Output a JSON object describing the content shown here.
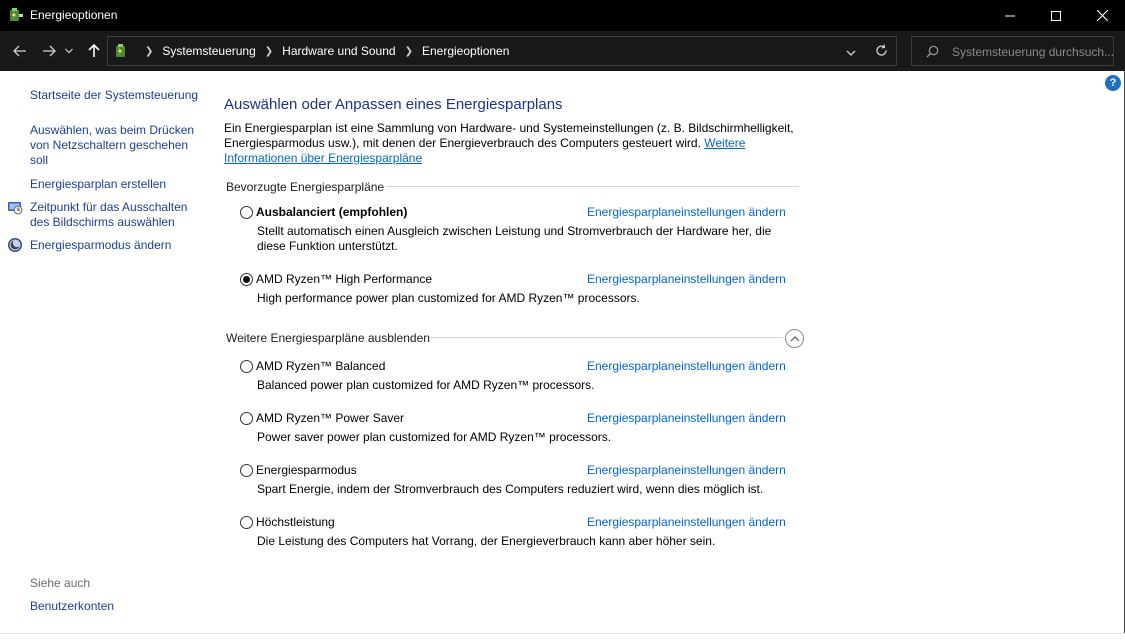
{
  "window": {
    "title": "Energieoptionen"
  },
  "navbar": {
    "breadcrumbs": [
      "Systemsteuerung",
      "Hardware und Sound",
      "Energieoptionen"
    ],
    "search_placeholder": "Systemsteuerung durchsuch..."
  },
  "help_label": "?",
  "sidebar": {
    "home": "Startseite der Systemsteuerung",
    "links": [
      "Auswählen, was beim Drücken von Netzschaltern geschehen soll",
      "Energiesparplan erstellen",
      "Zeitpunkt für das Ausschalten des Bildschirms auswählen",
      "Energiesparmodus ändern"
    ],
    "see_also": "Siehe auch",
    "see_also_links": [
      "Benutzerkonten"
    ]
  },
  "main": {
    "title": "Auswählen oder Anpassen eines Energiesparplans",
    "intro_text": "Ein Energiesparplan ist eine Sammlung von Hardware- und Systemeinstellungen (z. B. Bildschirmhelligkeit, Energiesparmodus usw.), mit denen der Energieverbrauch des Computers gesteuert wird. ",
    "intro_link": "Weitere Informationen über Energiesparpläne",
    "preferred_header": "Bevorzugte Energiesparpläne",
    "more_header": "Weitere Energiesparpläne ausblenden",
    "change_link": "Energiesparplaneinstellungen ändern",
    "plans": [
      {
        "name": "Ausbalanciert (empfohlen)",
        "desc": "Stellt automatisch einen Ausgleich zwischen Leistung und Stromverbrauch der Hardware her, die diese Funktion unterstützt.",
        "selected": false
      },
      {
        "name": "AMD Ryzen™ High Performance",
        "desc": "High performance power plan customized for AMD Ryzen™ processors.",
        "selected": true
      },
      {
        "name": "AMD Ryzen™ Balanced",
        "desc": "Balanced power plan customized for AMD Ryzen™ processors.",
        "selected": false
      },
      {
        "name": "AMD Ryzen™ Power Saver",
        "desc": "Power saver power plan customized for AMD Ryzen™ processors.",
        "selected": false
      },
      {
        "name": "Energiesparmodus",
        "desc": "Spart Energie, indem der Stromverbrauch des Computers reduziert wird, wenn dies möglich ist.",
        "selected": false
      },
      {
        "name": "Höchstleistung",
        "desc": "Die Leistung des Computers hat Vorrang, der Energieverbrauch kann aber höher sein.",
        "selected": false
      }
    ]
  },
  "colors": {
    "link": "#0066cc",
    "title": "#1e3287",
    "titlebar": "#000000"
  }
}
